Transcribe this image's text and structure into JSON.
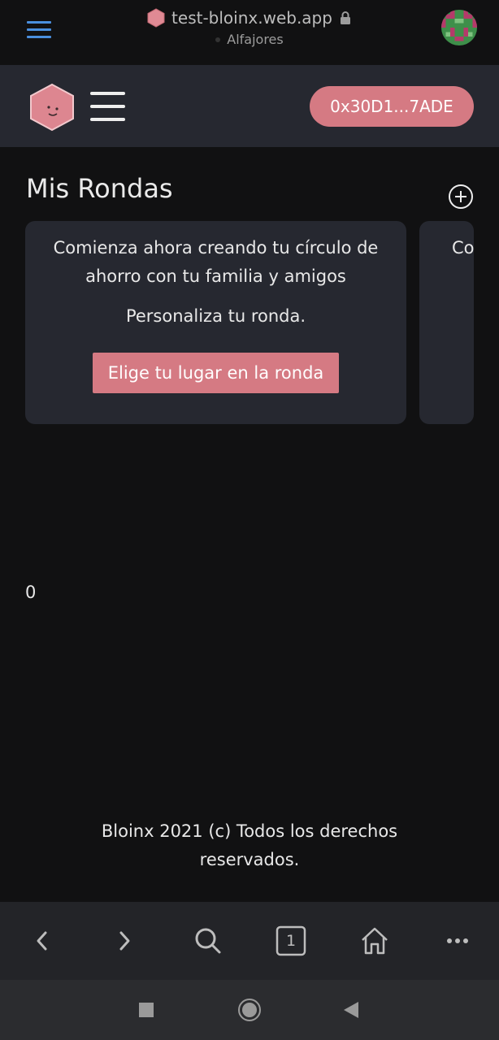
{
  "browser": {
    "url": "test-bloinx.web.app",
    "network": "Alfajores",
    "tab_count": "1"
  },
  "header": {
    "wallet_address": "0x30D1...7ADE"
  },
  "main": {
    "title": "Mis Rondas",
    "card1": {
      "text": "Comienza ahora creando tu círculo de ahorro con tu familia y amigos",
      "subtext": "Personaliza tu ronda.",
      "button_label": "Elige tu lugar en la ronda"
    },
    "card2": {
      "text": "Co"
    },
    "counter": "0"
  },
  "footer": {
    "text": "Bloinx 2021 (c) Todos los derechos reservados."
  },
  "colors": {
    "accent": "#d57a83",
    "header_bg": "#262830",
    "page_bg": "#111112",
    "menu_blue": "#4a8fde"
  },
  "icons": [
    "menu-icon",
    "lock-icon",
    "logo-icon",
    "hamburger-icon",
    "add-circle-icon",
    "back-icon",
    "forward-icon",
    "search-icon",
    "tabs-icon",
    "home-icon",
    "more-icon",
    "recents-icon",
    "home-circle-icon",
    "back-triangle-icon"
  ]
}
